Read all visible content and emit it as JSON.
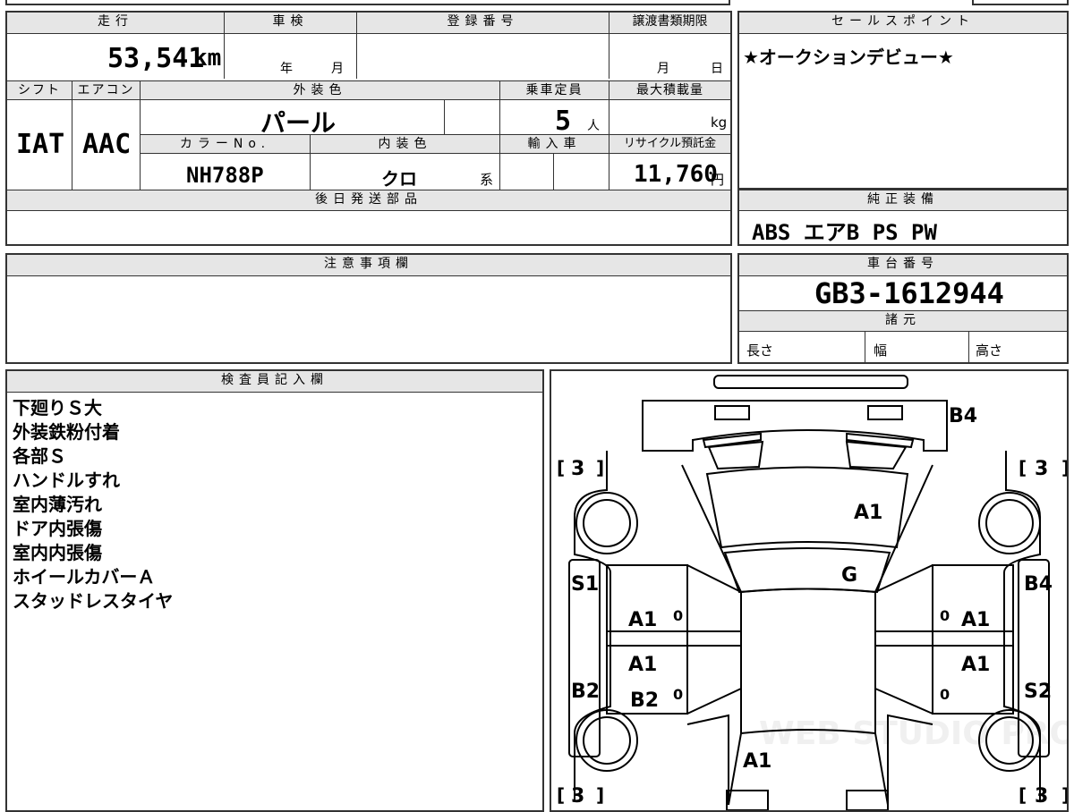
{
  "mileage": {
    "header": "走行",
    "value": "53,541",
    "unit": "km"
  },
  "inspection": {
    "header": "車検",
    "year": "年",
    "month": "月"
  },
  "registration": {
    "header": "登録番号",
    "value": ""
  },
  "transfer": {
    "header": "譲渡書類期限",
    "month": "月",
    "day": "日"
  },
  "shift": {
    "header": "シフト",
    "value": "IAT"
  },
  "aircon": {
    "header": "エアコン",
    "value": "AAC"
  },
  "exterior": {
    "header": "外装色",
    "value": "パール"
  },
  "capacity": {
    "header": "乗車定員",
    "value": "5",
    "unit": "人"
  },
  "maxload": {
    "header": "最大積載量",
    "unit": "kg"
  },
  "color_no": {
    "header": "カラーNo.",
    "value": "NH788P"
  },
  "interior": {
    "header": "内装色",
    "value": "クロ",
    "suffix": "系"
  },
  "import": {
    "header": "輸入車"
  },
  "recycle": {
    "header": "リサイクル預託金",
    "value": "11,760",
    "unit": "円"
  },
  "later_parts": {
    "header": "後日発送部品",
    "value": ""
  },
  "sales_point": {
    "header": "セールスポイント",
    "value": "★オークションデビュー★"
  },
  "equipment": {
    "header": "純正装備",
    "value": "ABS エアB PS PW"
  },
  "notes": {
    "header": "注意事項欄",
    "value": ""
  },
  "chassis": {
    "header": "車台番号",
    "value": "GB3-1612944"
  },
  "specs": {
    "header": "諸元",
    "length": "長さ",
    "width": "幅",
    "height": "高さ"
  },
  "inspector": {
    "header": "検査員記入欄",
    "lines": [
      "下廻りＳ大",
      "外装鉄粉付着",
      "各部Ｓ",
      "ハンドルすれ",
      "室内薄汚れ",
      "ドア内張傷",
      "室内内張傷",
      "ホイールカバーＡ",
      "スタッドレスタイヤ"
    ]
  },
  "diagram": {
    "marks": {
      "rear": "B4",
      "trunk": "A1",
      "roof": "G",
      "left_rear_fender": "S1",
      "right_rear_fender": "B4",
      "left_rear_door": "A1",
      "right_rear_door": "A1",
      "left_front_door_top": "A1",
      "left_front_door_bottom": "B2",
      "right_front_door": "A1",
      "left_front_fender": "B2",
      "right_front_fender": "S2",
      "hood": "A1"
    },
    "tires": {
      "tl": "3",
      "tr": "3",
      "bl": "3",
      "br": "3"
    },
    "zeros": [
      "0",
      "0",
      "0",
      "0"
    ],
    "watermark": "WEB STUDIO PRO"
  }
}
